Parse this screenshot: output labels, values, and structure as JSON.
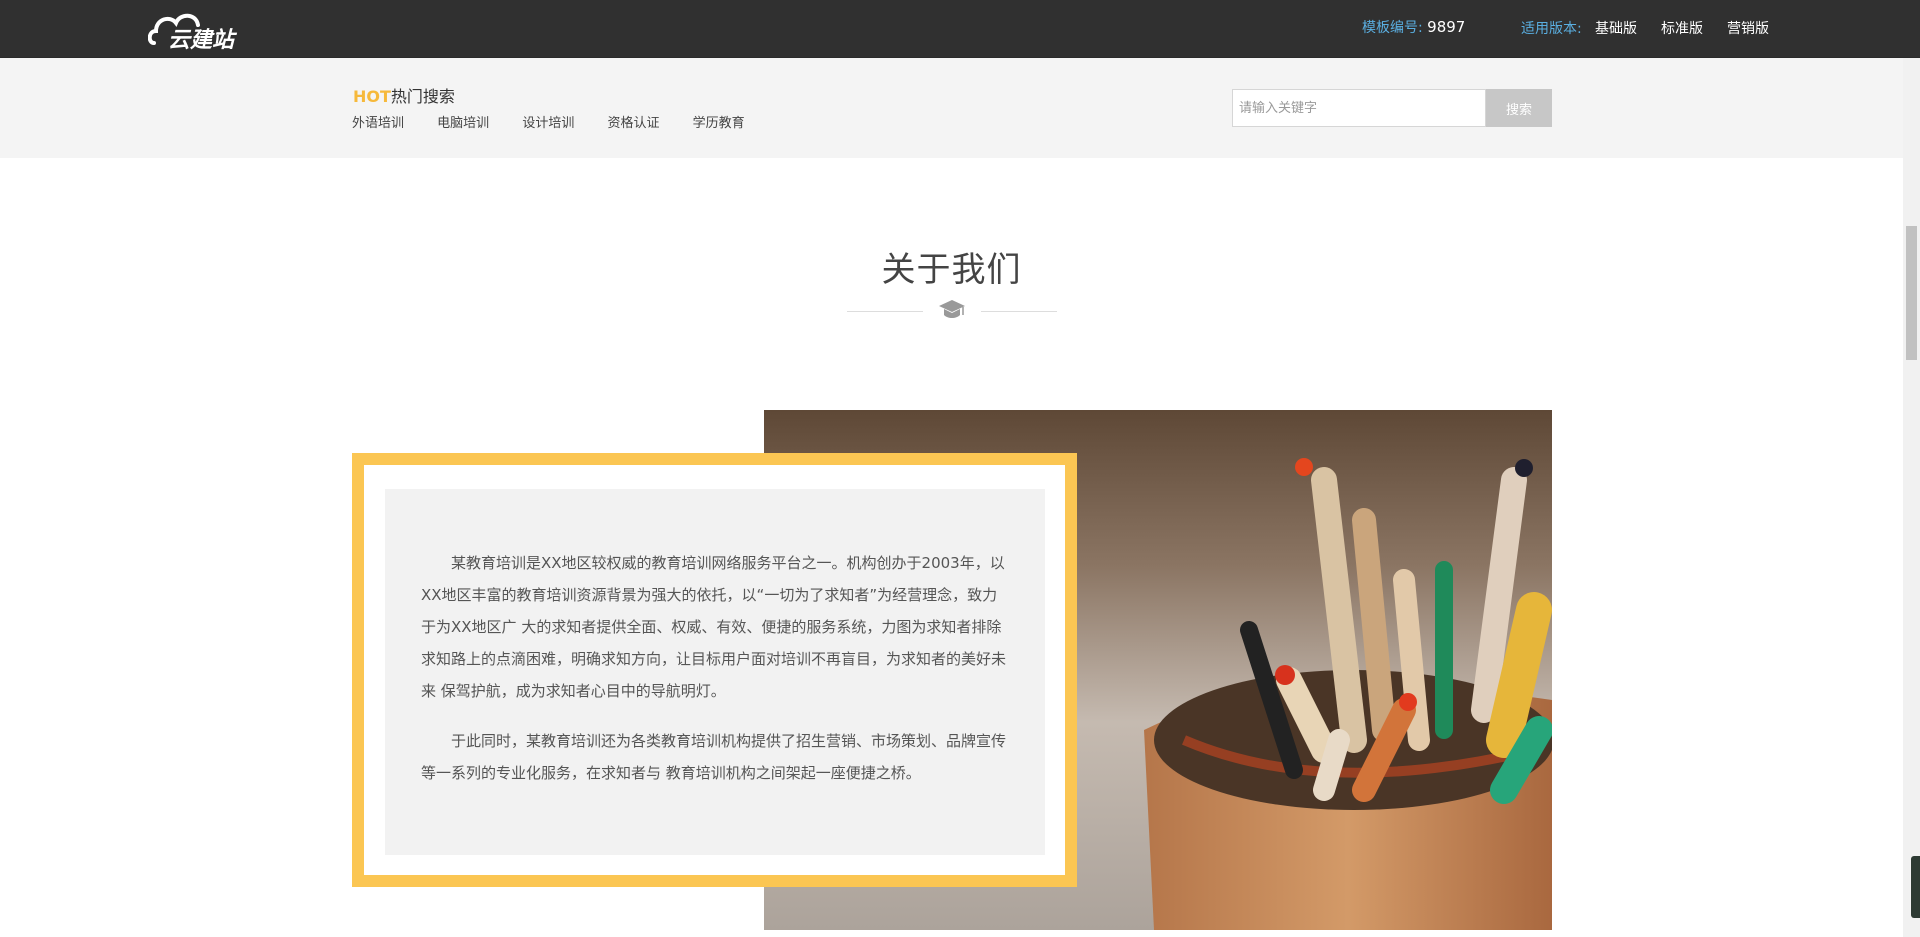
{
  "brand": {
    "logo_text": "云建站"
  },
  "topbar": {
    "template_label": "模板编号:",
    "template_id": "9897",
    "version_label": "适用版本:",
    "versions": [
      "基础版",
      "标准版",
      "营销版"
    ]
  },
  "search": {
    "hot_prefix": "HOT",
    "hot_title": "热门搜索",
    "hot_links": [
      "外语培训",
      "电脑培训",
      "设计培训",
      "资格认证",
      "学历教育"
    ],
    "placeholder": "请输入关键字",
    "button_label": "搜索"
  },
  "about": {
    "title": "关于我们",
    "paragraphs": [
      "某教育培训是XX地区较权威的教育培训网络服务平台之一。机构创办于2003年，以XX地区丰富的教育培训资源背景为强大的依托，以“一切为了求知者”为经营理念，致力于为XX地区广 大的求知者提供全面、权威、有效、便捷的服务系统，力图为求知者排除求知路上的点滴困难，明确求知方向，让目标用户面对培训不再盲目，为求知者的美好未来 保驾护航，成为求知者心目中的导航明灯。",
      "于此同时，某教育培训还为各类教育培训机构提供了招生营销、市场策划、品牌宣传等一系列的专业化服务，在求知者与 教育培训机构之间架起一座便捷之桥。"
    ]
  },
  "colors": {
    "topbar_bg": "#303030",
    "accent_yellow": "#fbc653",
    "hot_orange": "#f6b93b",
    "link_blue": "#5aaee0",
    "search_button": "#c7c7c7"
  },
  "icons": {
    "section_divider": "graduation-cap-icon",
    "logo": "cloud-logo-icon"
  }
}
